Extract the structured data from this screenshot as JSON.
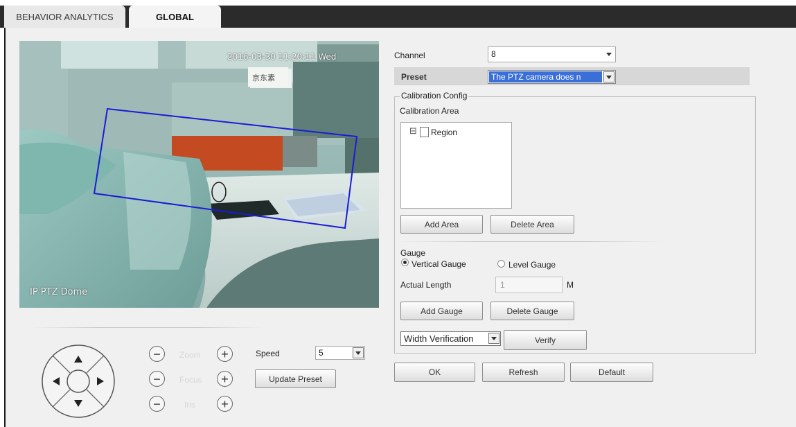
{
  "tabs": [
    {
      "label": "BEHAVIOR ANALYTICS"
    },
    {
      "label": "GLOBAL"
    }
  ],
  "video": {
    "timestamp": "2016-03-30 11:20:11 Wed",
    "camera_name": "IP PTZ Dome",
    "sign_text": "京东素"
  },
  "ptz": {
    "zoom_label": "Zoom",
    "focus_label": "Focus",
    "iris_label": "Iris",
    "minus": "−",
    "plus": "+",
    "speed_label": "Speed",
    "speed_value": "5",
    "update_preset": "Update Preset"
  },
  "form": {
    "channel_label": "Channel",
    "channel_value": "8",
    "preset_label": "Preset",
    "preset_value": "The PTZ camera does n",
    "calibration_legend": "Calibration Config",
    "calibration_area_label": "Calibration Area",
    "tree_expander": "⊟",
    "tree_root": "Region",
    "add_area": "Add Area",
    "delete_area": "Delete Area",
    "gauge_label": "Gauge",
    "vertical_gauge": "Vertical Gauge",
    "level_gauge": "Level Gauge",
    "gauge_selected": "Vertical Gauge",
    "actual_length_label": "Actual Length",
    "actual_length_value": "1",
    "actual_length_unit": "M",
    "add_gauge": "Add Gauge",
    "delete_gauge": "Delete Gauge",
    "verification_value": "Width Verification",
    "verify": "Verify"
  },
  "footer": {
    "ok": "OK",
    "refresh": "Refresh",
    "default": "Default"
  },
  "colors": {
    "topbar": "#2b2b2b",
    "panel": "#f0f0f0",
    "selection": "#3a6fd8",
    "region_line": "#1b1bd6"
  }
}
